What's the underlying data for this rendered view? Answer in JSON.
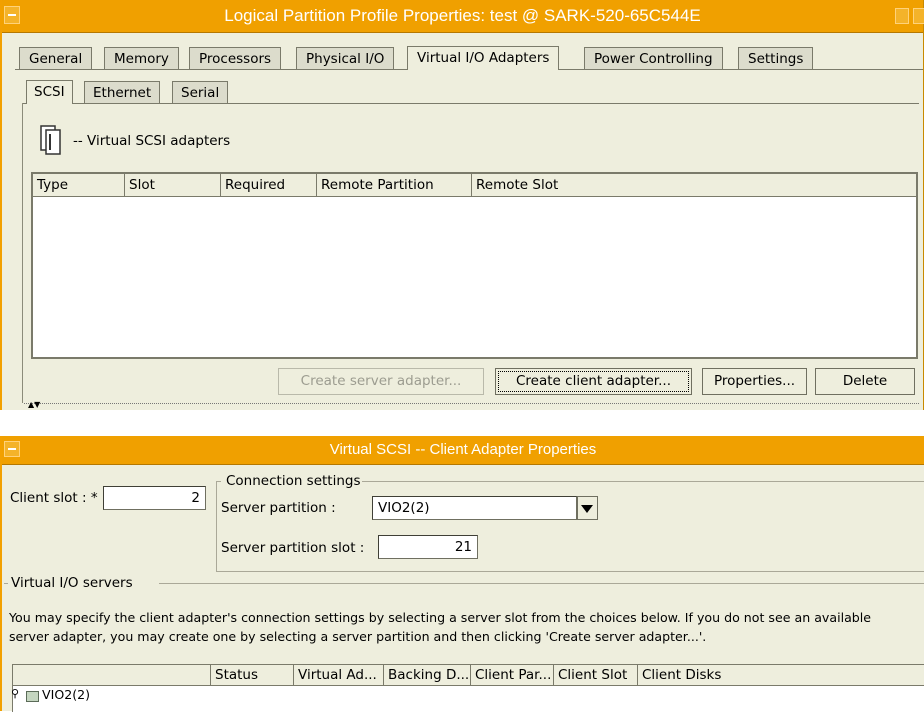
{
  "window1": {
    "title": "Logical Partition Profile Properties: test @ SARK-520-65C544E",
    "tabs": [
      "General",
      "Memory",
      "Processors",
      "Physical I/O",
      "Virtual I/O Adapters",
      "Power Controlling",
      "Settings"
    ],
    "subtabs": [
      "SCSI",
      "Ethernet",
      "Serial"
    ],
    "section_label": "-- Virtual SCSI adapters",
    "table_columns": [
      "Type",
      "Slot",
      "Required",
      "Remote Partition",
      "Remote Slot"
    ],
    "buttons": {
      "create_server": "Create server adapter...",
      "create_client": "Create client adapter...",
      "properties": "Properties...",
      "delete": "Delete"
    }
  },
  "window2": {
    "title": "Virtual SCSI --  Client Adapter Properties",
    "client_slot_label": "Client slot : *",
    "client_slot_value": "2",
    "connection_group": "Connection settings",
    "server_partition_label": "Server partition :",
    "server_partition_value": "VIO2(2)",
    "server_slot_label": "Server partition slot :",
    "server_slot_value": "21",
    "vio_group": "Virtual I/O servers",
    "info_line1": "You may specify the client adapter's connection settings by selecting a server slot from the choices below. If you do not see an available",
    "info_line2": "server adapter, you may create one by selecting a server partition and then clicking 'Create server adapter...'.",
    "table_columns": [
      "Status",
      "Virtual Ad...",
      "Backing D...",
      "Client Par...",
      "Client Slot",
      "Client Disks"
    ],
    "tree_row": "VIO2(2)"
  },
  "icons": [
    "window-menu-icon",
    "adapter-icon",
    "dropdown-arrow-icon",
    "tree-node-icon",
    "server-icon"
  ]
}
